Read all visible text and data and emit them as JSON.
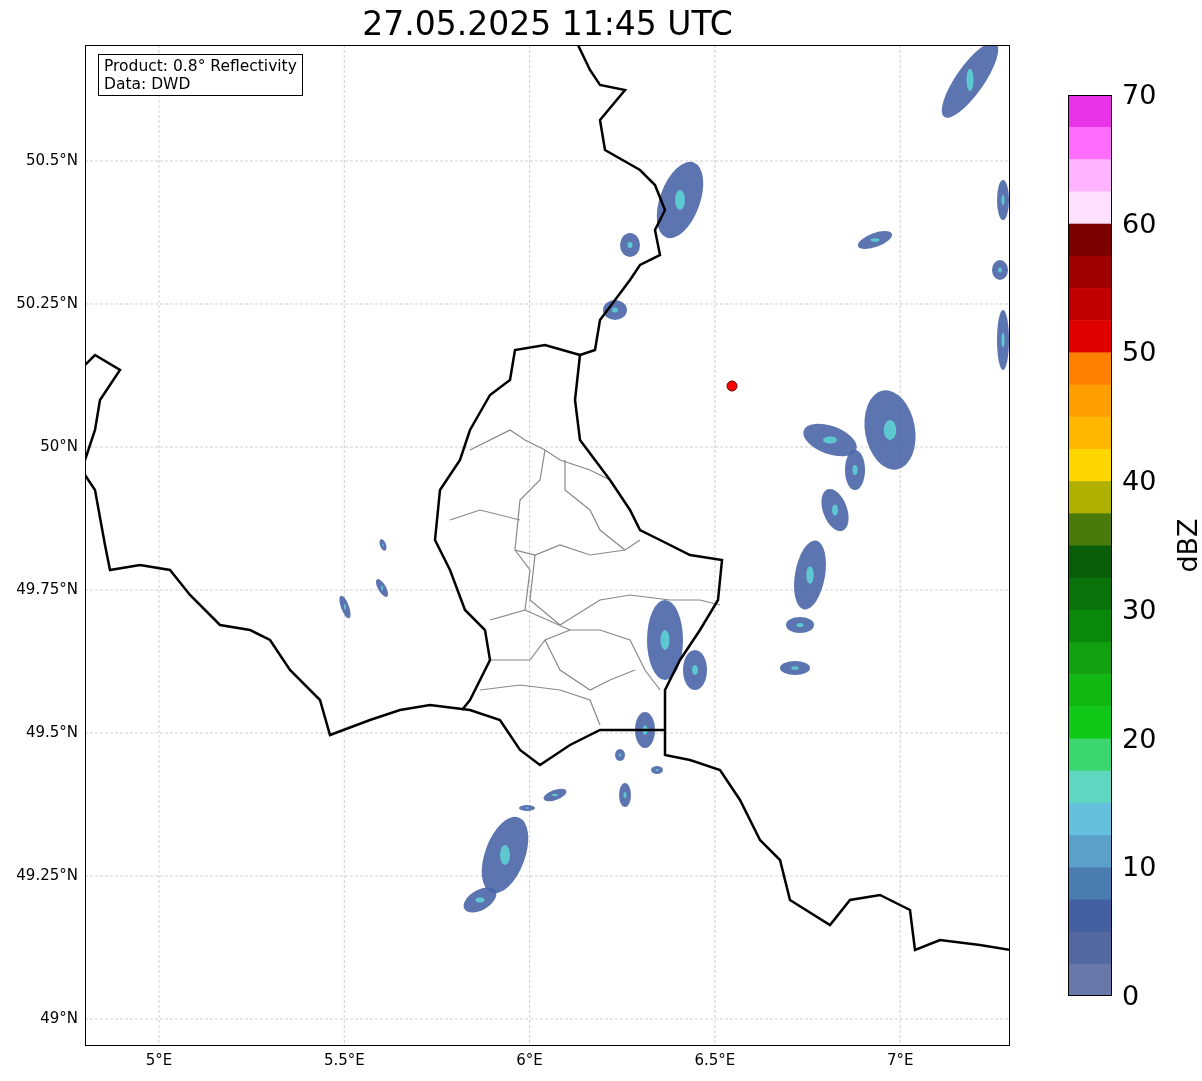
{
  "title": "27.05.2025 11:45 UTC",
  "info_box": {
    "lines": [
      "Product: 0.8° Reflectivity",
      "Data: DWD"
    ]
  },
  "map": {
    "lat_ticks": [
      "50.5°N",
      "50.25°N",
      "50°N",
      "49.75°N",
      "49.5°N",
      "49.25°N",
      "49°N"
    ],
    "lon_ticks": [
      "5°E",
      "5.5°E",
      "6°E",
      "6.5°E",
      "7°E"
    ]
  },
  "colorbar": {
    "label": "dBZ",
    "ticks": [
      "70",
      "60",
      "50",
      "40",
      "30",
      "20",
      "10",
      "0"
    ]
  }
}
